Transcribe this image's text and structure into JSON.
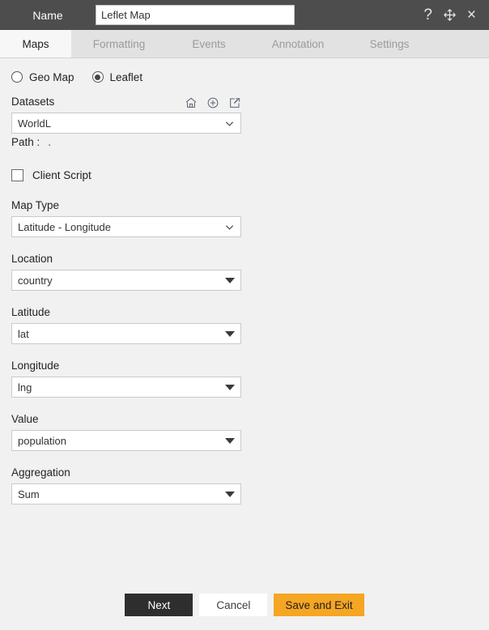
{
  "titlebar": {
    "label": "Name",
    "name_value": "Leflet Map",
    "icons": {
      "help": "?",
      "move": "move-icon",
      "close": "×"
    }
  },
  "tabs": [
    {
      "label": "Maps",
      "active": true
    },
    {
      "label": "Formatting",
      "active": false
    },
    {
      "label": "Events",
      "active": false
    },
    {
      "label": "Annotation",
      "active": false
    },
    {
      "label": "Settings",
      "active": false
    }
  ],
  "map_source": {
    "options": [
      {
        "label": "Geo Map",
        "selected": false
      },
      {
        "label": "Leaflet",
        "selected": true
      }
    ]
  },
  "datasets": {
    "label": "Datasets",
    "value": "WorldL",
    "icons": [
      "home-icon",
      "plus-circle-icon",
      "edit-icon"
    ],
    "path_label": "Path :",
    "path_value": "."
  },
  "client_script": {
    "label": "Client Script",
    "checked": false
  },
  "fields": [
    {
      "label": "Map Type",
      "value": "Latitude - Longitude",
      "arrow": "chevron"
    },
    {
      "label": "Location",
      "value": "country",
      "arrow": "caret"
    },
    {
      "label": "Latitude",
      "value": "lat",
      "arrow": "caret"
    },
    {
      "label": "Longitude",
      "value": "lng",
      "arrow": "caret"
    },
    {
      "label": "Value",
      "value": "population",
      "arrow": "caret"
    },
    {
      "label": "Aggregation",
      "value": "Sum",
      "arrow": "caret"
    }
  ],
  "footer": {
    "next": "Next",
    "cancel": "Cancel",
    "save": "Save and Exit"
  },
  "colors": {
    "titlebar": "#4d4d4d",
    "accent_orange": "#f5a623",
    "dark_button": "#2e2e2e",
    "background": "#f1f1f1"
  }
}
